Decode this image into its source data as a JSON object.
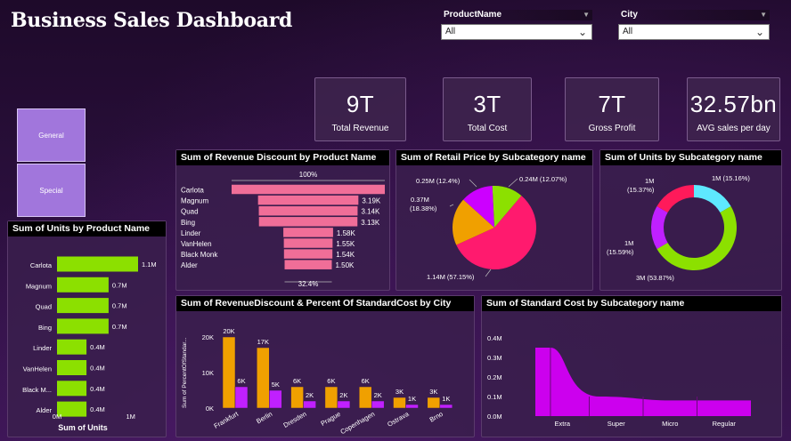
{
  "header": {
    "title": "Business Sales Dashboard"
  },
  "filters": [
    {
      "label": "ProductName",
      "value": "All"
    },
    {
      "label": "City",
      "value": "All"
    }
  ],
  "kpis": [
    {
      "value": "9T",
      "label": "Total Revenue"
    },
    {
      "value": "3T",
      "label": "Total Cost"
    },
    {
      "value": "7T",
      "label": "Gross Profit"
    },
    {
      "value": "32.57bn",
      "label": "AVG sales per day"
    }
  ],
  "nav_buttons": [
    {
      "label": "General"
    },
    {
      "label": "Special"
    }
  ],
  "colors": {
    "green": "#8ce000",
    "orange": "#f0a000",
    "purple": "#c020ff",
    "pink": "#f06e98",
    "magenta": "#cc00ee",
    "cyan": "#5ee8ff",
    "red": "#ff1a5a"
  },
  "chart_data": [
    {
      "id": "units_by_product",
      "type": "bar",
      "orientation": "horizontal",
      "title": "Sum of Units by Product Name",
      "categories": [
        "Carlota",
        "Magnum",
        "Quad",
        "Bing",
        "Linder",
        "VanHelen",
        "Black M...",
        "Alder"
      ],
      "values": [
        1.1,
        0.7,
        0.7,
        0.7,
        0.4,
        0.4,
        0.4,
        0.4
      ],
      "value_labels": [
        "1.1M",
        "0.7M",
        "0.7M",
        "0.7M",
        "0.4M",
        "0.4M",
        "0.4M",
        "0.4M"
      ],
      "xlabel": "Sum of Units",
      "xticks": [
        "0M",
        "1M"
      ],
      "xlim": [
        0,
        1.2
      ]
    },
    {
      "id": "revenue_discount_funnel",
      "type": "bar",
      "orientation": "funnel",
      "title": "Sum of Revenue Discount by Product Name",
      "categories": [
        "Carlota",
        "Magnum",
        "Quad",
        "Bing",
        "Linder",
        "VanHelen",
        "Black Monk",
        "Alder"
      ],
      "values": [
        4.87,
        3.19,
        3.14,
        3.13,
        1.58,
        1.55,
        1.54,
        1.5
      ],
      "value_labels": [
        "",
        "3.19K",
        "3.14K",
        "3.13K",
        "1.58K",
        "1.55K",
        "1.54K",
        "1.50K"
      ],
      "top_label": "100%",
      "bottom_label": "32.4%"
    },
    {
      "id": "retail_price_pie",
      "type": "pie",
      "title": "Sum of Retail Price by Subcategory name",
      "slices": [
        {
          "value": 1.14,
          "label": "1.14M (57.15%)",
          "color": "#ff1a6e"
        },
        {
          "value": 0.37,
          "label": "0.37M (18.38%)",
          "color": "#f0a000"
        },
        {
          "value": 0.25,
          "label": "0.25M (12.4%)",
          "color": "#cc00ff"
        },
        {
          "value": 0.24,
          "label": "0.24M (12.07%)",
          "color": "#8ce000"
        }
      ]
    },
    {
      "id": "units_donut",
      "type": "pie",
      "title": "Sum of Units by Subcategory name",
      "slices": [
        {
          "value": 3,
          "label": "3M (53.87%)",
          "color": "#8ce000"
        },
        {
          "value": 1,
          "label": "1M (15.59%)",
          "color": "#c020ff"
        },
        {
          "value": 1,
          "label": "1M (15.37%)",
          "color": "#ff1a5a"
        },
        {
          "value": 1,
          "label": "1M (15.16%)",
          "color": "#5ee8ff"
        }
      ]
    },
    {
      "id": "revenue_discount_by_city",
      "type": "bar",
      "title": "Sum of RevenueDiscount & Percent Of StandardCost by City",
      "ylabel": "Sum of PercentOfStandar...",
      "categories": [
        "Frankfurt",
        "Berlin",
        "Dresden",
        "Prague",
        "Copenhagen",
        "Ostrava",
        "Brno"
      ],
      "yticks": [
        "0K",
        "10K",
        "20K"
      ],
      "ylim": [
        0,
        22
      ],
      "series": [
        {
          "name": "Sum of RevenueDiscount",
          "values": [
            20,
            17,
            6,
            6,
            6,
            3,
            3
          ],
          "labels": [
            "20K",
            "17K",
            "6K",
            "6K",
            "6K",
            "3K",
            "3K"
          ],
          "color": "#f0a000"
        },
        {
          "name": "Sum of PercentOfStandardCost",
          "values": [
            6,
            5,
            2,
            2,
            2,
            1,
            1
          ],
          "labels": [
            "6K",
            "5K",
            "2K",
            "2K",
            "2K",
            "1K",
            "1K"
          ],
          "color": "#c020ff"
        }
      ]
    },
    {
      "id": "standard_cost_area",
      "type": "area",
      "title": "Sum of Standard Cost by Subcategory name",
      "categories": [
        "Extra",
        "Super",
        "Micro",
        "Regular"
      ],
      "yticks": [
        "0.0M",
        "0.1M",
        "0.2M",
        "0.3M",
        "0.4M"
      ],
      "ylim": [
        0,
        0.4
      ],
      "values": [
        0.35,
        0.1,
        0.08,
        0.08
      ],
      "color": "#cc00ee"
    }
  ]
}
